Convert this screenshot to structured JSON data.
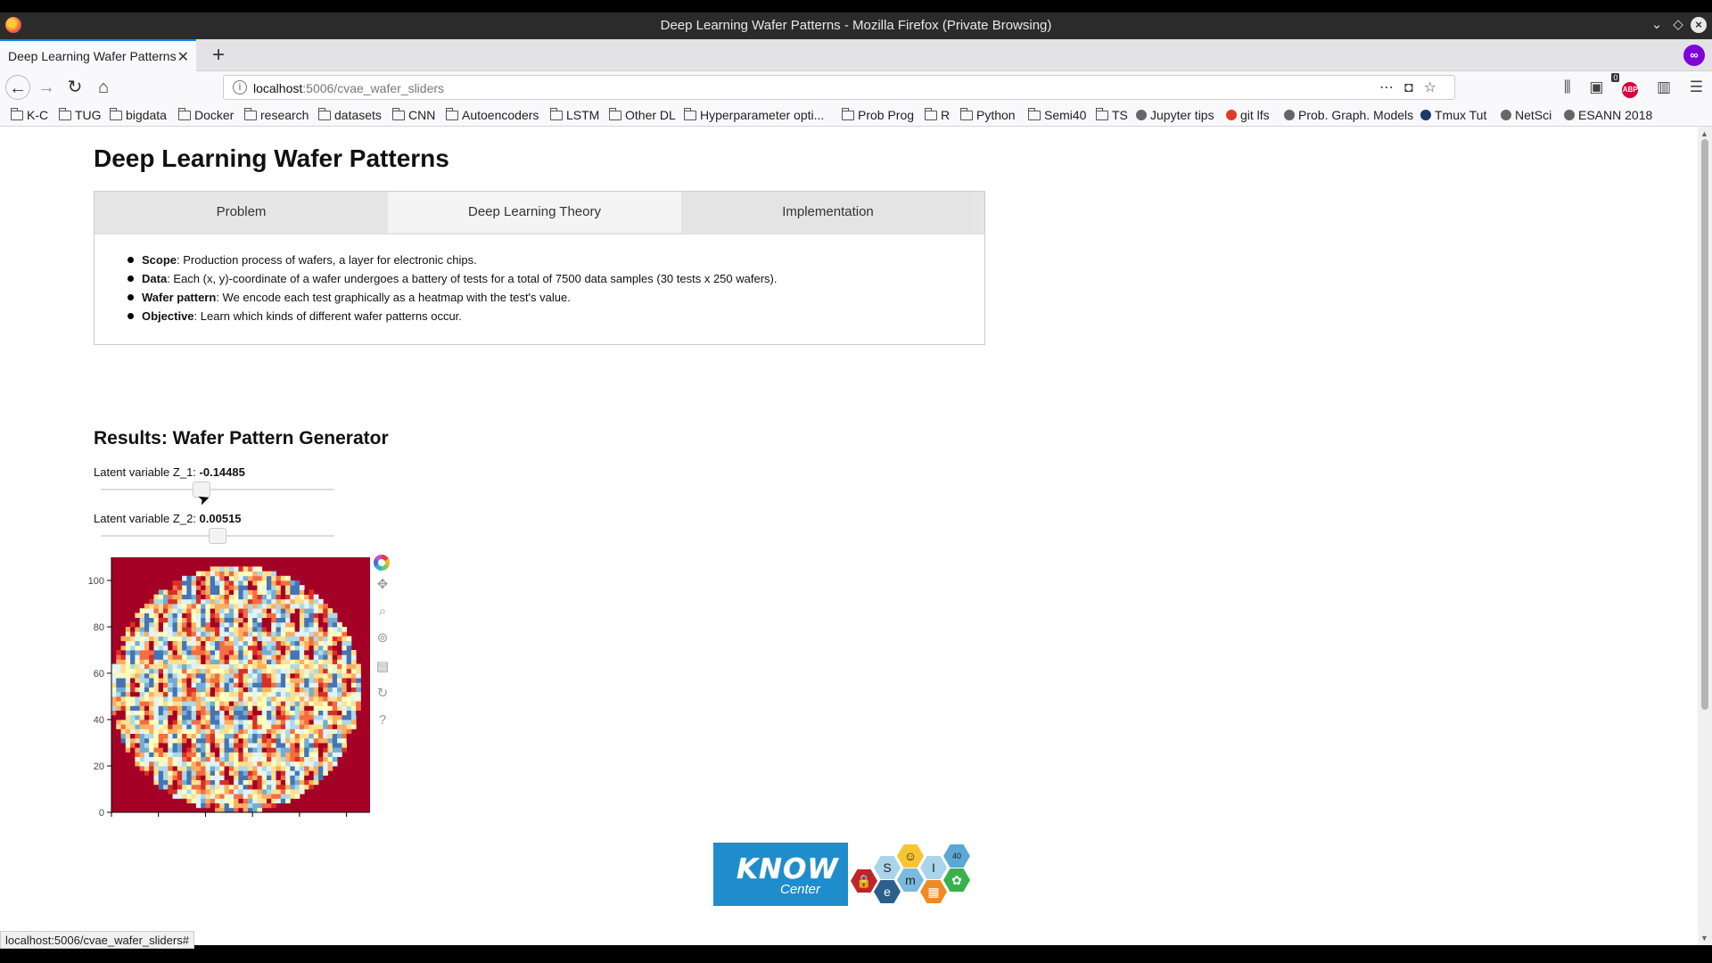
{
  "window": {
    "title": "Deep Learning Wafer Patterns - Mozilla Firefox (Private Browsing)"
  },
  "tab": {
    "title": "Deep Learning Wafer Patterns"
  },
  "url": {
    "host": "localhost",
    "rest": ":5006/cvae_wafer_sliders"
  },
  "bookmarks": [
    "K-C",
    "TUG",
    "bigdata",
    "Docker",
    "research",
    "datasets",
    "CNN",
    "Autoencoders",
    "LSTM",
    "Other DL",
    "Hyperparameter opti...",
    "Prob Prog",
    "R",
    "Python",
    "Semi40",
    "TS",
    "Jupyter tips",
    "git lfs",
    "Prob. Graph. Models",
    "Tmux Tut",
    "NetSci",
    "ESANN 2018"
  ],
  "toolbar_badge": "0",
  "page": {
    "title": "Deep Learning Wafer Patterns",
    "tabs": [
      "Problem",
      "Deep Learning Theory",
      "Implementation"
    ],
    "bullets": [
      {
        "term": "Scope",
        "text": ": Production process of wafers, a layer for electronic chips."
      },
      {
        "term": "Data",
        "text": ": Each (x, y)-coordinate of a wafer undergoes a battery of tests for a total of 7500 data samples (30 tests x 250 wafers)."
      },
      {
        "term": "Wafer pattern",
        "text": ": We encode each test graphically as a heatmap with the test's value."
      },
      {
        "term": "Objective",
        "text": ": Learn which kinds of different wafer patterns occur."
      }
    ],
    "results_title": "Results: Wafer Pattern Generator",
    "slider1": {
      "label": "Latent variable Z_1: ",
      "value": "-0.14485",
      "position": 0.43
    },
    "slider2": {
      "label": "Latent variable Z_2: ",
      "value": "0.00515",
      "position": 0.5
    },
    "logo": {
      "know": "KNOW",
      "center": "Center",
      "hex_letters": [
        "S",
        "I",
        "m",
        "e",
        "40"
      ]
    }
  },
  "status_url": "localhost:5006/cvae_wafer_sliders#",
  "chart_data": {
    "type": "heatmap",
    "title": "",
    "xlabel": "",
    "ylabel": "",
    "xlim": [
      0,
      110
    ],
    "ylim": [
      0,
      110
    ],
    "xticks": [
      0,
      20,
      40,
      60,
      80,
      100
    ],
    "yticks": [
      0,
      20,
      40,
      60,
      80,
      100
    ],
    "background_color": "#a50026",
    "wafer": {
      "center": [
        53,
        53
      ],
      "radius": 53
    },
    "colormap": [
      "#a50026",
      "#d73027",
      "#f46d43",
      "#fdae61",
      "#fee090",
      "#ffffbf",
      "#e0f3f8",
      "#abd9e9",
      "#74add1",
      "#4575b4"
    ]
  },
  "colors": {
    "accent": "#0a84ff",
    "know_blue": "#1f8ccc"
  }
}
